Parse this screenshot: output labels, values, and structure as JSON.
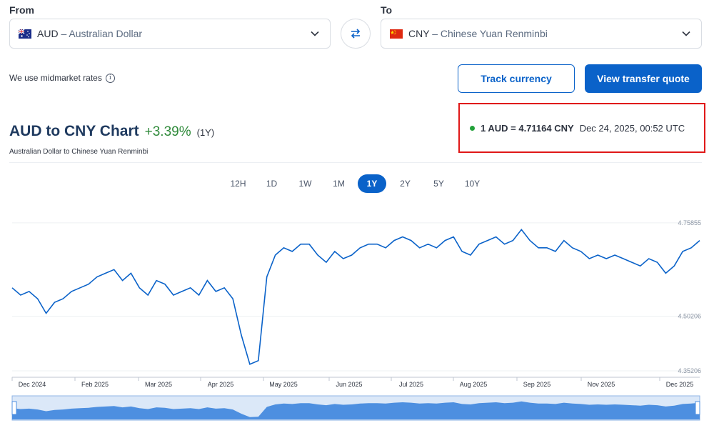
{
  "from": {
    "label": "From",
    "code": "AUD",
    "name": "Australian Dollar",
    "separator": " – ",
    "flag_icon": "flag-australia-icon"
  },
  "to": {
    "label": "To",
    "code": "CNY",
    "name": "Chinese Yuan Renminbi",
    "separator": " – ",
    "flag_icon": "flag-china-icon"
  },
  "midmarket_note": "We use midmarket rates",
  "buttons": {
    "track": "Track currency",
    "quote": "View transfer quote"
  },
  "chart_header": {
    "title": "AUD to CNY Chart",
    "change": "+3.39%",
    "period": "(1Y)",
    "subtitle": "Australian Dollar to Chinese Yuan Renminbi"
  },
  "rate": {
    "value": "1 AUD = 4.71164 CNY",
    "timestamp": "Dec 24, 2025, 00:52 UTC"
  },
  "tabs": [
    "12H",
    "1D",
    "1W",
    "1M",
    "1Y",
    "2Y",
    "5Y",
    "10Y"
  ],
  "active_tab": "1Y",
  "colors": {
    "accent": "#0a62c9",
    "positive": "#2f8a3a",
    "highlight_border": "#e01818"
  },
  "chart_data": {
    "type": "line",
    "title": "",
    "xlabel": "",
    "ylabel": "",
    "ylim": [
      4.35,
      4.77
    ],
    "y_ticks": [
      "4.75855",
      "4.50206",
      "4.35206"
    ],
    "x_ticks": [
      "Dec 2024",
      "Feb 2025",
      "Mar 2025",
      "Apr 2025",
      "May 2025",
      "Jun 2025",
      "Jul 2025",
      "Aug 2025",
      "Sep 2025",
      "Nov 2025",
      "Dec 2025"
    ],
    "series": [
      {
        "values": [
          4.58,
          4.56,
          4.57,
          4.55,
          4.51,
          4.54,
          4.55,
          4.57,
          4.58,
          4.59,
          4.61,
          4.62,
          4.63,
          4.6,
          4.62,
          4.58,
          4.56,
          4.6,
          4.59,
          4.56,
          4.57,
          4.58,
          4.56,
          4.6,
          4.57,
          4.58,
          4.55,
          4.45,
          4.37,
          4.38,
          4.61,
          4.67,
          4.69,
          4.68,
          4.7,
          4.7,
          4.67,
          4.65,
          4.68,
          4.66,
          4.67,
          4.69,
          4.7,
          4.7,
          4.69,
          4.71,
          4.72,
          4.71,
          4.69,
          4.7,
          4.69,
          4.71,
          4.72,
          4.68,
          4.67,
          4.7,
          4.71,
          4.72,
          4.7,
          4.71,
          4.74,
          4.71,
          4.69,
          4.69,
          4.68,
          4.71,
          4.69,
          4.68,
          4.66,
          4.67,
          4.66,
          4.67,
          4.66,
          4.65,
          4.64,
          4.66,
          4.65,
          4.62,
          4.64,
          4.68,
          4.69,
          4.71
        ]
      }
    ]
  },
  "navigator": {
    "handle_icon": "range-handle-icon"
  }
}
